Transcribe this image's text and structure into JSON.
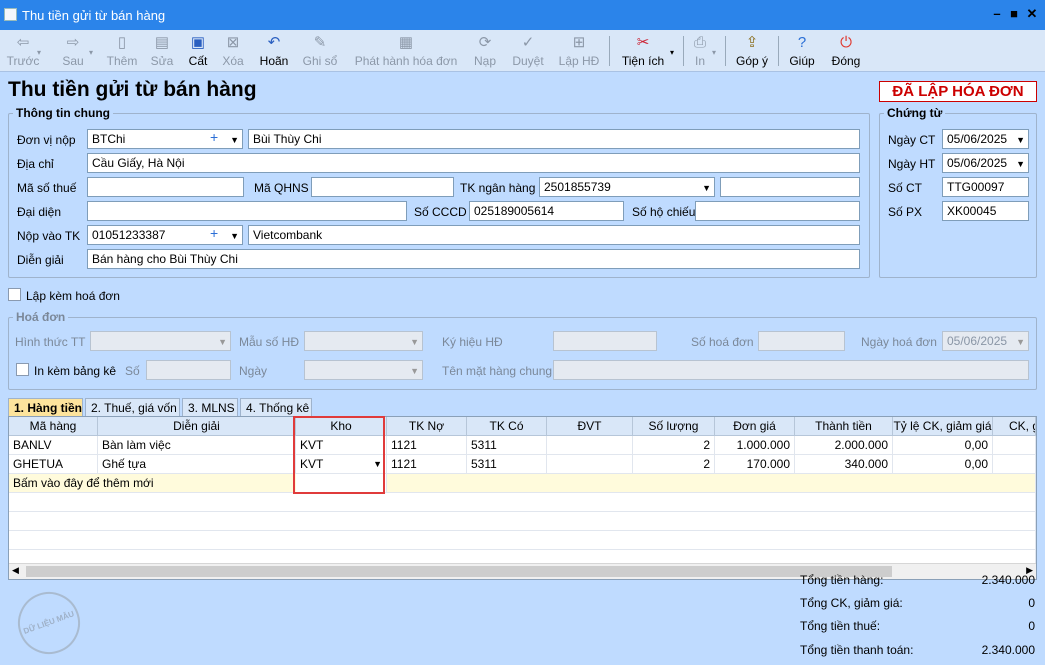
{
  "window": {
    "title": "Thu tiền gửi từ bán hàng"
  },
  "toolbar": {
    "prev": "Trước",
    "next": "Sau",
    "add": "Thêm",
    "edit": "Sửa",
    "cut": "Cất",
    "delete": "Xóa",
    "undo": "Hoãn",
    "post": "Ghi sổ",
    "issue_invoice": "Phát hành hóa đơn",
    "load": "Nạp",
    "approve": "Duyệt",
    "create_hd": "Lập HĐ",
    "utilities": "Tiện ích",
    "print": "In",
    "feedback": "Góp ý",
    "help": "Giúp",
    "close": "Đóng"
  },
  "page": {
    "title": "Thu tiền gửi từ bán hàng",
    "status_badge": "ĐÃ LẬP HÓA ĐƠN"
  },
  "general": {
    "legend": "Thông tin chung",
    "don_vi_nop_label": "Đơn vị nộp",
    "don_vi_nop_code": "BTChi",
    "don_vi_nop_name": "Bùi Thùy Chi",
    "dia_chi_label": "Địa chỉ",
    "dia_chi": "Cầu Giấy, Hà Nội",
    "ma_so_thue_label": "Mã số thuế",
    "ma_so_thue": "",
    "ma_qhns_label": "Mã QHNS",
    "ma_qhns": "",
    "tk_ngan_hang_label": "TK ngân hàng",
    "tk_ngan_hang": "2501855739",
    "tk_ngan_hang_extra": "",
    "dai_dien_label": "Đại diện",
    "dai_dien": "",
    "so_cccd_label": "Số CCCD",
    "so_cccd": "025189005614",
    "so_ho_chieu_label": "Số hộ chiếu",
    "so_ho_chieu": "",
    "nop_vao_tk_label": "Nộp vào TK",
    "nop_vao_tk": "01051233387",
    "nop_vao_tk_bank": "Vietcombank",
    "dien_giai_label": "Diễn giải",
    "dien_giai": "Bán hàng cho Bùi Thùy Chi"
  },
  "voucher": {
    "legend": "Chứng từ",
    "ngay_ct_label": "Ngày CT",
    "ngay_ct": "05/06/2025",
    "ngay_ht_label": "Ngày HT",
    "ngay_ht": "05/06/2025",
    "so_ct_label": "Số CT",
    "so_ct": "TTG00097",
    "so_px_label": "Số PX",
    "so_px": "XK00045"
  },
  "attach_invoice_label": "Lập kèm hoá đơn",
  "invoice": {
    "legend": "Hoá đơn",
    "hinh_thuc_tt_label": "Hình thức TT",
    "mau_so_hd_label": "Mẫu số HĐ",
    "ky_hieu_hd_label": "Ký hiệu HĐ",
    "so_hoa_don_label": "Số hoá đơn",
    "ngay_hoa_don_label": "Ngày hoá đơn",
    "ngay_hoa_don": "05/06/2025",
    "in_kem_bang_ke_label": "In kèm bảng kê",
    "so_label": "Số",
    "ngay_label": "Ngày",
    "ten_mat_hang_chung_label": "Tên mặt hàng chung"
  },
  "tabs": [
    "1. Hàng tiền",
    "2. Thuế, giá vốn",
    "3. MLNS",
    "4. Thống kê"
  ],
  "grid": {
    "columns": [
      "Mã hàng",
      "Diễn giải",
      "Kho",
      "TK Nợ",
      "TK Có",
      "ĐVT",
      "Số lượng",
      "Đơn giá",
      "Thành tiền",
      "Tỷ lệ CK, giảm giá",
      "CK, g"
    ],
    "rows": [
      [
        "BANLV",
        "Bàn làm việc",
        "KVT",
        "1121",
        "5311",
        "",
        "2",
        "1.000.000",
        "2.000.000",
        "0,00",
        ""
      ],
      [
        "GHETUA",
        "Ghế tựa",
        "KVT",
        "1121",
        "5311",
        "",
        "2",
        "170.000",
        "340.000",
        "0,00",
        ""
      ]
    ],
    "add_hint": "Bấm vào đây để thêm mới"
  },
  "totals": {
    "tong_tien_hang_label": "Tổng tiền hàng:",
    "tong_tien_hang": "2.340.000",
    "tong_ck_label": "Tổng CK, giảm giá:",
    "tong_ck": "0",
    "tong_thue_label": "Tổng tiền thuế:",
    "tong_thue": "0",
    "tong_thanh_toan_label": "Tổng tiền thanh toán:",
    "tong_thanh_toan": "2.340.000"
  },
  "watermark": "DỮ LIỆU MẪU"
}
